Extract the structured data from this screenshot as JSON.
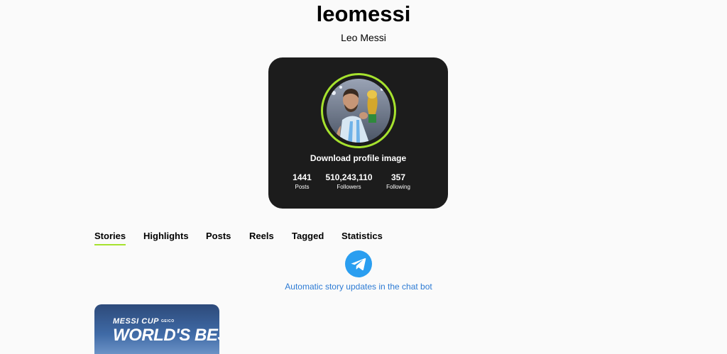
{
  "profile": {
    "username": "leomessi",
    "full_name": "Leo Messi",
    "download_label": "Download profile image",
    "stats": {
      "posts": {
        "value": "1441",
        "label": "Posts"
      },
      "followers": {
        "value": "510,243,110",
        "label": "Followers"
      },
      "following": {
        "value": "357",
        "label": "Following"
      }
    }
  },
  "tabs": [
    {
      "label": "Stories",
      "active": true
    },
    {
      "label": "Highlights"
    },
    {
      "label": "Posts"
    },
    {
      "label": "Reels"
    },
    {
      "label": "Tagged"
    },
    {
      "label": "Statistics"
    }
  ],
  "telegram": {
    "icon": "telegram-icon",
    "link_text": "Automatic story updates in the chat bot"
  },
  "story": {
    "title": "MESSI CUP",
    "sponsor": "GEICO",
    "headline": "WORLD'S BEST"
  },
  "colors": {
    "accent": "#a6e22e",
    "card_bg": "#1c1c1c",
    "telegram_blue": "#2a9ef0",
    "link_blue": "#2d7bd4"
  }
}
